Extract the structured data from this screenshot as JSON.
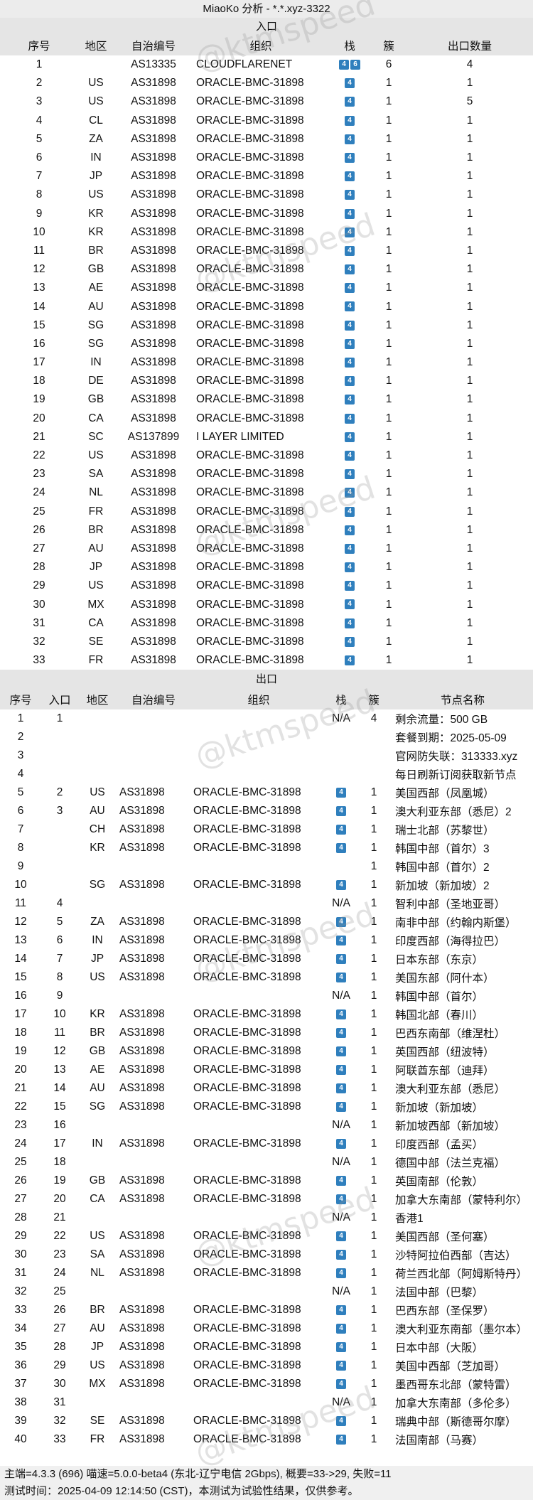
{
  "title": "MiaoKo 分析 - *.*.xyz-3322",
  "watermark": "@ktmspeed",
  "inbound": {
    "section_title": "入口",
    "headers": [
      "序号",
      "地区",
      "自治编号",
      "组织",
      "栈",
      "簇",
      "出口数量"
    ],
    "rows": [
      [
        "1",
        "",
        "AS13335",
        "CLOUDFLARENET",
        "46",
        "6",
        "4"
      ],
      [
        "2",
        "US",
        "AS31898",
        "ORACLE-BMC-31898",
        "4",
        "1",
        "1"
      ],
      [
        "3",
        "US",
        "AS31898",
        "ORACLE-BMC-31898",
        "4",
        "1",
        "5"
      ],
      [
        "4",
        "CL",
        "AS31898",
        "ORACLE-BMC-31898",
        "4",
        "1",
        "1"
      ],
      [
        "5",
        "ZA",
        "AS31898",
        "ORACLE-BMC-31898",
        "4",
        "1",
        "1"
      ],
      [
        "6",
        "IN",
        "AS31898",
        "ORACLE-BMC-31898",
        "4",
        "1",
        "1"
      ],
      [
        "7",
        "JP",
        "AS31898",
        "ORACLE-BMC-31898",
        "4",
        "1",
        "1"
      ],
      [
        "8",
        "US",
        "AS31898",
        "ORACLE-BMC-31898",
        "4",
        "1",
        "1"
      ],
      [
        "9",
        "KR",
        "AS31898",
        "ORACLE-BMC-31898",
        "4",
        "1",
        "1"
      ],
      [
        "10",
        "KR",
        "AS31898",
        "ORACLE-BMC-31898",
        "4",
        "1",
        "1"
      ],
      [
        "11",
        "BR",
        "AS31898",
        "ORACLE-BMC-31898",
        "4",
        "1",
        "1"
      ],
      [
        "12",
        "GB",
        "AS31898",
        "ORACLE-BMC-31898",
        "4",
        "1",
        "1"
      ],
      [
        "13",
        "AE",
        "AS31898",
        "ORACLE-BMC-31898",
        "4",
        "1",
        "1"
      ],
      [
        "14",
        "AU",
        "AS31898",
        "ORACLE-BMC-31898",
        "4",
        "1",
        "1"
      ],
      [
        "15",
        "SG",
        "AS31898",
        "ORACLE-BMC-31898",
        "4",
        "1",
        "1"
      ],
      [
        "16",
        "SG",
        "AS31898",
        "ORACLE-BMC-31898",
        "4",
        "1",
        "1"
      ],
      [
        "17",
        "IN",
        "AS31898",
        "ORACLE-BMC-31898",
        "4",
        "1",
        "1"
      ],
      [
        "18",
        "DE",
        "AS31898",
        "ORACLE-BMC-31898",
        "4",
        "1",
        "1"
      ],
      [
        "19",
        "GB",
        "AS31898",
        "ORACLE-BMC-31898",
        "4",
        "1",
        "1"
      ],
      [
        "20",
        "CA",
        "AS31898",
        "ORACLE-BMC-31898",
        "4",
        "1",
        "1"
      ],
      [
        "21",
        "SC",
        "AS137899",
        "I LAYER LIMITED",
        "4",
        "1",
        "1"
      ],
      [
        "22",
        "US",
        "AS31898",
        "ORACLE-BMC-31898",
        "4",
        "1",
        "1"
      ],
      [
        "23",
        "SA",
        "AS31898",
        "ORACLE-BMC-31898",
        "4",
        "1",
        "1"
      ],
      [
        "24",
        "NL",
        "AS31898",
        "ORACLE-BMC-31898",
        "4",
        "1",
        "1"
      ],
      [
        "25",
        "FR",
        "AS31898",
        "ORACLE-BMC-31898",
        "4",
        "1",
        "1"
      ],
      [
        "26",
        "BR",
        "AS31898",
        "ORACLE-BMC-31898",
        "4",
        "1",
        "1"
      ],
      [
        "27",
        "AU",
        "AS31898",
        "ORACLE-BMC-31898",
        "4",
        "1",
        "1"
      ],
      [
        "28",
        "JP",
        "AS31898",
        "ORACLE-BMC-31898",
        "4",
        "1",
        "1"
      ],
      [
        "29",
        "US",
        "AS31898",
        "ORACLE-BMC-31898",
        "4",
        "1",
        "1"
      ],
      [
        "30",
        "MX",
        "AS31898",
        "ORACLE-BMC-31898",
        "4",
        "1",
        "1"
      ],
      [
        "31",
        "CA",
        "AS31898",
        "ORACLE-BMC-31898",
        "4",
        "1",
        "1"
      ],
      [
        "32",
        "SE",
        "AS31898",
        "ORACLE-BMC-31898",
        "4",
        "1",
        "1"
      ],
      [
        "33",
        "FR",
        "AS31898",
        "ORACLE-BMC-31898",
        "4",
        "1",
        "1"
      ]
    ]
  },
  "outbound": {
    "section_title": "出口",
    "headers": [
      "序号",
      "入口",
      "地区",
      "自治编号",
      "组织",
      "栈",
      "簇",
      "节点名称"
    ],
    "rows": [
      [
        "1",
        "1",
        "",
        "",
        "",
        "N/A",
        "4",
        "剩余流量：500 GB"
      ],
      [
        "2",
        "",
        "",
        "",
        "",
        "",
        "",
        "套餐到期：2025-05-09"
      ],
      [
        "3",
        "",
        "",
        "",
        "",
        "",
        "",
        "官网防失联：313333.xyz"
      ],
      [
        "4",
        "",
        "",
        "",
        "",
        "",
        "",
        "每日刷新订阅获取新节点"
      ],
      [
        "5",
        "2",
        "US",
        "AS31898",
        "ORACLE-BMC-31898",
        "4",
        "1",
        "美国西部（凤凰城）"
      ],
      [
        "6",
        "3",
        "AU",
        "AS31898",
        "ORACLE-BMC-31898",
        "4",
        "1",
        "澳大利亚东部（悉尼）2"
      ],
      [
        "7",
        "",
        "CH",
        "AS31898",
        "ORACLE-BMC-31898",
        "4",
        "1",
        "瑞士北部（苏黎世）"
      ],
      [
        "8",
        "",
        "KR",
        "AS31898",
        "ORACLE-BMC-31898",
        "4",
        "1",
        "韩国中部（首尔）3"
      ],
      [
        "9",
        "",
        "",
        "",
        "",
        "",
        "1",
        "韩国中部（首尔）2"
      ],
      [
        "10",
        "",
        "SG",
        "AS31898",
        "ORACLE-BMC-31898",
        "4",
        "1",
        "新加坡（新加坡）2"
      ],
      [
        "11",
        "4",
        "",
        "",
        "",
        "N/A",
        "1",
        "智利中部（圣地亚哥）"
      ],
      [
        "12",
        "5",
        "ZA",
        "AS31898",
        "ORACLE-BMC-31898",
        "4",
        "1",
        "南非中部（约翰内斯堡）"
      ],
      [
        "13",
        "6",
        "IN",
        "AS31898",
        "ORACLE-BMC-31898",
        "4",
        "1",
        "印度西部（海得拉巴）"
      ],
      [
        "14",
        "7",
        "JP",
        "AS31898",
        "ORACLE-BMC-31898",
        "4",
        "1",
        "日本东部（东京）"
      ],
      [
        "15",
        "8",
        "US",
        "AS31898",
        "ORACLE-BMC-31898",
        "4",
        "1",
        "美国东部（阿什本）"
      ],
      [
        "16",
        "9",
        "",
        "",
        "",
        "N/A",
        "1",
        "韩国中部（首尔）"
      ],
      [
        "17",
        "10",
        "KR",
        "AS31898",
        "ORACLE-BMC-31898",
        "4",
        "1",
        "韩国北部（春川）"
      ],
      [
        "18",
        "11",
        "BR",
        "AS31898",
        "ORACLE-BMC-31898",
        "4",
        "1",
        "巴西东南部（维涅杜）"
      ],
      [
        "19",
        "12",
        "GB",
        "AS31898",
        "ORACLE-BMC-31898",
        "4",
        "1",
        "英国西部（纽波特）"
      ],
      [
        "20",
        "13",
        "AE",
        "AS31898",
        "ORACLE-BMC-31898",
        "4",
        "1",
        "阿联酋东部（迪拜）"
      ],
      [
        "21",
        "14",
        "AU",
        "AS31898",
        "ORACLE-BMC-31898",
        "4",
        "1",
        "澳大利亚东部（悉尼）"
      ],
      [
        "22",
        "15",
        "SG",
        "AS31898",
        "ORACLE-BMC-31898",
        "4",
        "1",
        "新加坡（新加坡）"
      ],
      [
        "23",
        "16",
        "",
        "",
        "",
        "N/A",
        "1",
        "新加坡西部（新加坡）"
      ],
      [
        "24",
        "17",
        "IN",
        "AS31898",
        "ORACLE-BMC-31898",
        "4",
        "1",
        "印度西部（孟买）"
      ],
      [
        "25",
        "18",
        "",
        "",
        "",
        "N/A",
        "1",
        "德国中部（法兰克福）"
      ],
      [
        "26",
        "19",
        "GB",
        "AS31898",
        "ORACLE-BMC-31898",
        "4",
        "1",
        "英国南部（伦敦）"
      ],
      [
        "27",
        "20",
        "CA",
        "AS31898",
        "ORACLE-BMC-31898",
        "4",
        "1",
        "加拿大东南部（蒙特利尔）"
      ],
      [
        "28",
        "21",
        "",
        "",
        "",
        "N/A",
        "1",
        "香港1"
      ],
      [
        "29",
        "22",
        "US",
        "AS31898",
        "ORACLE-BMC-31898",
        "4",
        "1",
        "美国西部（圣何塞）"
      ],
      [
        "30",
        "23",
        "SA",
        "AS31898",
        "ORACLE-BMC-31898",
        "4",
        "1",
        "沙特阿拉伯西部（吉达）"
      ],
      [
        "31",
        "24",
        "NL",
        "AS31898",
        "ORACLE-BMC-31898",
        "4",
        "1",
        "荷兰西北部（阿姆斯特丹）"
      ],
      [
        "32",
        "25",
        "",
        "",
        "",
        "N/A",
        "1",
        "法国中部（巴黎）"
      ],
      [
        "33",
        "26",
        "BR",
        "AS31898",
        "ORACLE-BMC-31898",
        "4",
        "1",
        "巴西东部（圣保罗）"
      ],
      [
        "34",
        "27",
        "AU",
        "AS31898",
        "ORACLE-BMC-31898",
        "4",
        "1",
        "澳大利亚东南部（墨尔本）"
      ],
      [
        "35",
        "28",
        "JP",
        "AS31898",
        "ORACLE-BMC-31898",
        "4",
        "1",
        "日本中部（大阪）"
      ],
      [
        "36",
        "29",
        "US",
        "AS31898",
        "ORACLE-BMC-31898",
        "4",
        "1",
        "美国中西部（芝加哥）"
      ],
      [
        "37",
        "30",
        "MX",
        "AS31898",
        "ORACLE-BMC-31898",
        "4",
        "1",
        "墨西哥东北部（蒙特雷）"
      ],
      [
        "38",
        "31",
        "",
        "",
        "",
        "N/A",
        "1",
        "加拿大东南部（多伦多）"
      ],
      [
        "39",
        "32",
        "SE",
        "AS31898",
        "ORACLE-BMC-31898",
        "4",
        "1",
        "瑞典中部（斯德哥尔摩）"
      ],
      [
        "40",
        "33",
        "FR",
        "AS31898",
        "ORACLE-BMC-31898",
        "4",
        "1",
        "法国南部（马赛）"
      ]
    ]
  },
  "footer": {
    "line1": "主端=4.3.3 (696) 喵速=5.0.0-beta4 (东北-辽宁电信 2Gbps), 概要=33->29, 失败=11",
    "line2": "测试时间：2025-04-09 12:14:50 (CST)，本测试为试验性结果，仅供参考。"
  },
  "colors": {
    "stack_tag": "#2f7fbd",
    "header_bg": "#e5e5e5"
  }
}
